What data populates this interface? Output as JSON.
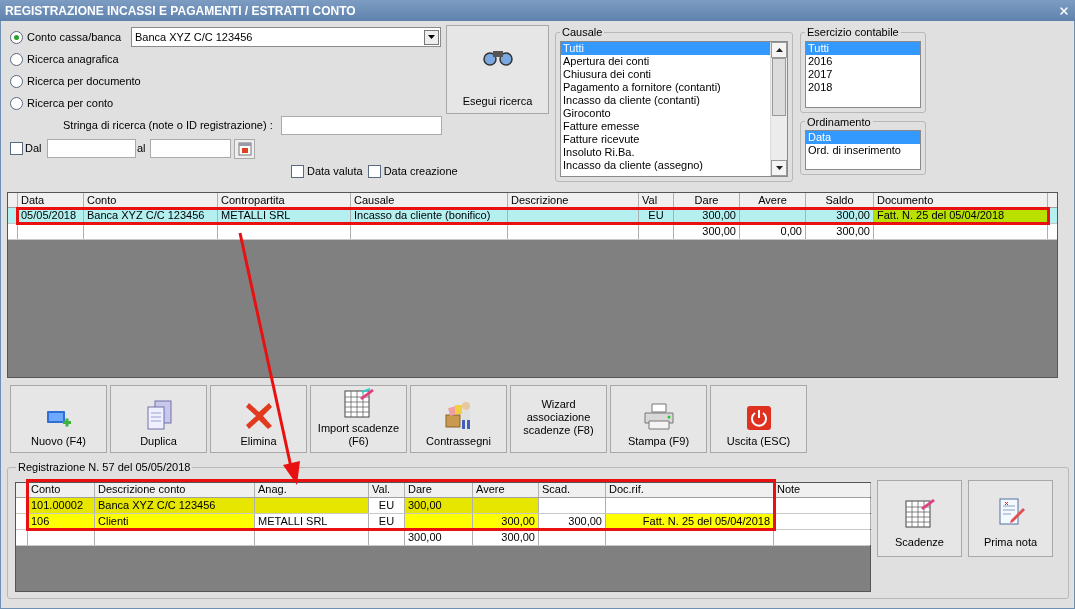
{
  "window": {
    "title": "REGISTRAZIONE INCASSI E PAGAMENTI / ESTRATTI CONTO"
  },
  "search_modes": [
    {
      "label": "Conto cassa/banca",
      "selected": true
    },
    {
      "label": "Ricerca anagrafica",
      "selected": false
    },
    {
      "label": "Ricerca per documento",
      "selected": false
    },
    {
      "label": "Ricerca per conto",
      "selected": false
    }
  ],
  "account_select": {
    "value": "Banca XYZ C/C 123456"
  },
  "search_string": {
    "label": "Stringa di ricerca (note o ID registrazione) :"
  },
  "date_range": {
    "label": "Dal",
    "checked": false,
    "to_label": "al"
  },
  "date_options": [
    {
      "label": "Data valuta",
      "checked": false
    },
    {
      "label": "Data creazione",
      "checked": false
    }
  ],
  "search_button": {
    "label": "Esegui ricerca"
  },
  "causale": {
    "title": "Causale",
    "items": [
      {
        "label": "Tutti",
        "selected": true
      },
      {
        "label": "Apertura dei conti",
        "selected": false
      },
      {
        "label": "Chiusura dei conti",
        "selected": false
      },
      {
        "label": "Pagamento a fornitore (contanti)",
        "selected": false
      },
      {
        "label": "Incasso da cliente (contanti)",
        "selected": false
      },
      {
        "label": "Giroconto",
        "selected": false
      },
      {
        "label": "Fatture emesse",
        "selected": false
      },
      {
        "label": "Fatture ricevute",
        "selected": false
      },
      {
        "label": "Insoluto Ri.Ba.",
        "selected": false
      },
      {
        "label": "Incasso da cliente (assegno)",
        "selected": false
      }
    ]
  },
  "esercizio": {
    "title": "Esercizio contabile",
    "items": [
      {
        "label": "Tutti",
        "selected": true
      },
      {
        "label": "2016",
        "selected": false
      },
      {
        "label": "2017",
        "selected": false
      },
      {
        "label": "2018",
        "selected": false
      }
    ]
  },
  "ordinamento": {
    "title": "Ordinamento",
    "items": [
      {
        "label": "Data",
        "selected": true
      },
      {
        "label": "Ord. di inserimento",
        "selected": false
      }
    ]
  },
  "movements_table": {
    "columns": [
      "Data",
      "Conto",
      "Contropartita",
      "Causale",
      "Descrizione",
      "Val",
      "Dare",
      "Avere",
      "Saldo",
      "Documento"
    ],
    "rows": [
      {
        "selected": true,
        "cells": {
          "data": {
            "text": "05/05/2018"
          },
          "conto": {
            "text": "Banca XYZ C/C 123456"
          },
          "contropartita": {
            "text": "METALLI SRL"
          },
          "causale": {
            "text": "Incasso da cliente (bonifico)"
          },
          "val": {
            "text": "EU"
          },
          "dare": {
            "text": "300,00"
          },
          "saldo": {
            "text": "300,00"
          },
          "documento": {
            "text": "Fatt. N. 25 del 05/04/2018",
            "color": "#b8e000"
          }
        }
      }
    ],
    "totals": {
      "dare": "300,00",
      "avere": "0,00",
      "saldo": "300,00"
    }
  },
  "actions": [
    {
      "label": "Nuovo (F4)",
      "kind": "new"
    },
    {
      "label": "Duplica",
      "kind": "duplicate"
    },
    {
      "label": "Elimina",
      "kind": "delete"
    },
    {
      "label": "Import scadenze (F6)",
      "kind": "import"
    },
    {
      "label": "Contrassegni",
      "kind": "courier"
    },
    {
      "label": "Wizard associazione scadenze (F8)",
      "kind": "text"
    },
    {
      "label": "Stampa (F9)",
      "kind": "print"
    },
    {
      "label": "Uscita (ESC)",
      "kind": "exit"
    }
  ],
  "registration": {
    "title": "Registrazione N. 57 del 05/05/2018",
    "columns": [
      "Conto",
      "Descrizione conto",
      "Anag.",
      "Val.",
      "Dare",
      "Avere",
      "Scad.",
      "Doc.rif.",
      "Note"
    ],
    "rows": [
      {
        "cells": {
          "conto": {
            "text": "101.00002",
            "color": "#e6e600"
          },
          "descrizione_conto": {
            "text": "Banca XYZ C/C 123456",
            "color": "#e6e600"
          },
          "anag": {
            "color": "#e6e600"
          },
          "val": {
            "text": "EU"
          },
          "dare": {
            "text": "300,00",
            "color": "#e6e600"
          },
          "avere": {
            "color": "#e6e600"
          }
        }
      },
      {
        "cells": {
          "conto": {
            "text": "106",
            "color": "#ffff00"
          },
          "descrizione_conto": {
            "text": "Clienti",
            "color": "#ffff00"
          },
          "anag": {
            "text": "METALLI SRL"
          },
          "val": {
            "text": "EU"
          },
          "dare": {
            "color": "#ffff00"
          },
          "avere": {
            "text": "300,00",
            "color": "#ffff00"
          },
          "scad": {
            "text": "300,00"
          },
          "doc_rif": {
            "text": "Fatt. N. 25 del 05/04/2018",
            "color": "#ffff00"
          }
        }
      }
    ],
    "totals": {
      "dare": "300,00",
      "avere": "300,00"
    },
    "buttons": [
      {
        "label": "Scadenze",
        "kind": "schedule"
      },
      {
        "label": "Prima nota",
        "kind": "journal"
      }
    ]
  }
}
